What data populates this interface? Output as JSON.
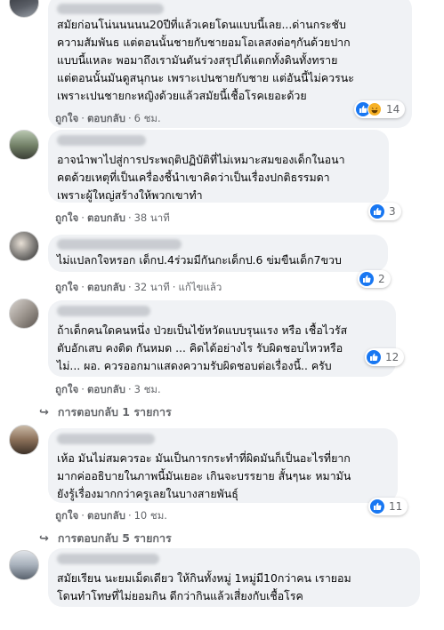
{
  "comments": [
    {
      "lines": [
        "สมัยก่อนโน่นนนนน20ปีที่แล้วเคยโดนแบบนี้เลย...ด่านกระชับ",
        "ความสัมพันธ แต่ตอนนั้นชายกับชายอมโอเลสงต่อๆกันด้วยปาก",
        "แบบนี้แหละ พอมาถึงเรามันดันร่วงสรุปได้แตกทั้งดินทั้งทราย",
        "แต่ตอนนั้นมันดูสนุกนะ เพราะเปนชายกับชาย แต่อันนี้ไม่ควรนะ",
        "เพราะเปนชายกะหญิงด้วยแล้วสมัยนี้เชื้อโรคเยอะด้วย"
      ],
      "like": "ถูกใจ",
      "reply": "ตอบกลับ",
      "time": "6 ชม.",
      "edited": "",
      "reactions": "14"
    },
    {
      "lines": [
        "อาจนำพาไปสู่การประพฤติปฏิบัติที่ไม่เหมาะสมของเด็กในอนา",
        "คตด้วยเหตุที่เป็นเครื่องชี้นำเขาคิดว่าเป็นเรื่องปกติธรรมดา",
        "เพราะผู้ใหญ่สร้างให้พวกเขาทำ"
      ],
      "like": "ถูกใจ",
      "reply": "ตอบกลับ",
      "time": "38 นาที",
      "edited": "",
      "reactions": "3"
    },
    {
      "lines": [
        "ไม่แปลกใจหรอก เด็กป.4ร่วมมีกันกะเด็กป.6 ข่มขืนเด็ก7ขวบ"
      ],
      "like": "ถูกใจ",
      "reply": "ตอบกลับ",
      "time": "32 นาที",
      "edited": "แก้ไขแล้ว",
      "reactions": "2"
    },
    {
      "lines": [
        "ถ้าเด็กคนใดคนหนึ่ง ป่วยเป็นไข้หวัดแบบรุนแรง หรือ เชื้อไวรัส",
        "ตับอักเสบ คงติด กันหมด ... คิดได้อย่างไร รับผิดชอบไหวหรือ",
        "ไม่... ผอ. ควรออกมาแสดงความรับผิดชอบต่อเรื่องนี้.. ครับ"
      ],
      "like": "ถูกใจ",
      "reply": "ตอบกลับ",
      "time": "3 ชม.",
      "edited": "",
      "reactions": "12",
      "replies": "การตอบกลับ 1 รายการ"
    },
    {
      "lines": [
        "เห้อ มันไม่สมควรอะ มันเป็นการกระทำที่ผิดมันก็เป็นอะไรที่ยาก",
        "มากค่ออธิบายในภาพนี้มันเยอะ เกินจะบรรยาย สั้นๆนะ หมามัน",
        "ยังรู้เรื่องมากกว่าครูเลยในบางสายพันธุ์"
      ],
      "like": "ถูกใจ",
      "reply": "ตอบกลับ",
      "time": "10 ชม.",
      "edited": "",
      "reactions": "11",
      "replies": "การตอบกลับ 5 รายการ"
    },
    {
      "lines": [
        "สมัยเรียน นะยมเม็ดเดียว ให้กินทั้งหมู่ 1หมู่มี10กว่าคน เรายอม",
        "โดนทำโทษที่ไม่ยอมกิน ดีกว่ากินแล้วเสี่ยงกับเชื้อโรค"
      ],
      "like": "",
      "reply": "",
      "time": "",
      "edited": "",
      "reactions": ""
    }
  ],
  "icons": {
    "like": "thumbs-up-icon",
    "haha": "haha-emoji-icon",
    "reply_arrow": "reply-arrow-icon"
  },
  "colors": {
    "bubble": "#f0f2f5",
    "meta": "#65676b",
    "like_blue": "#1877f2"
  }
}
